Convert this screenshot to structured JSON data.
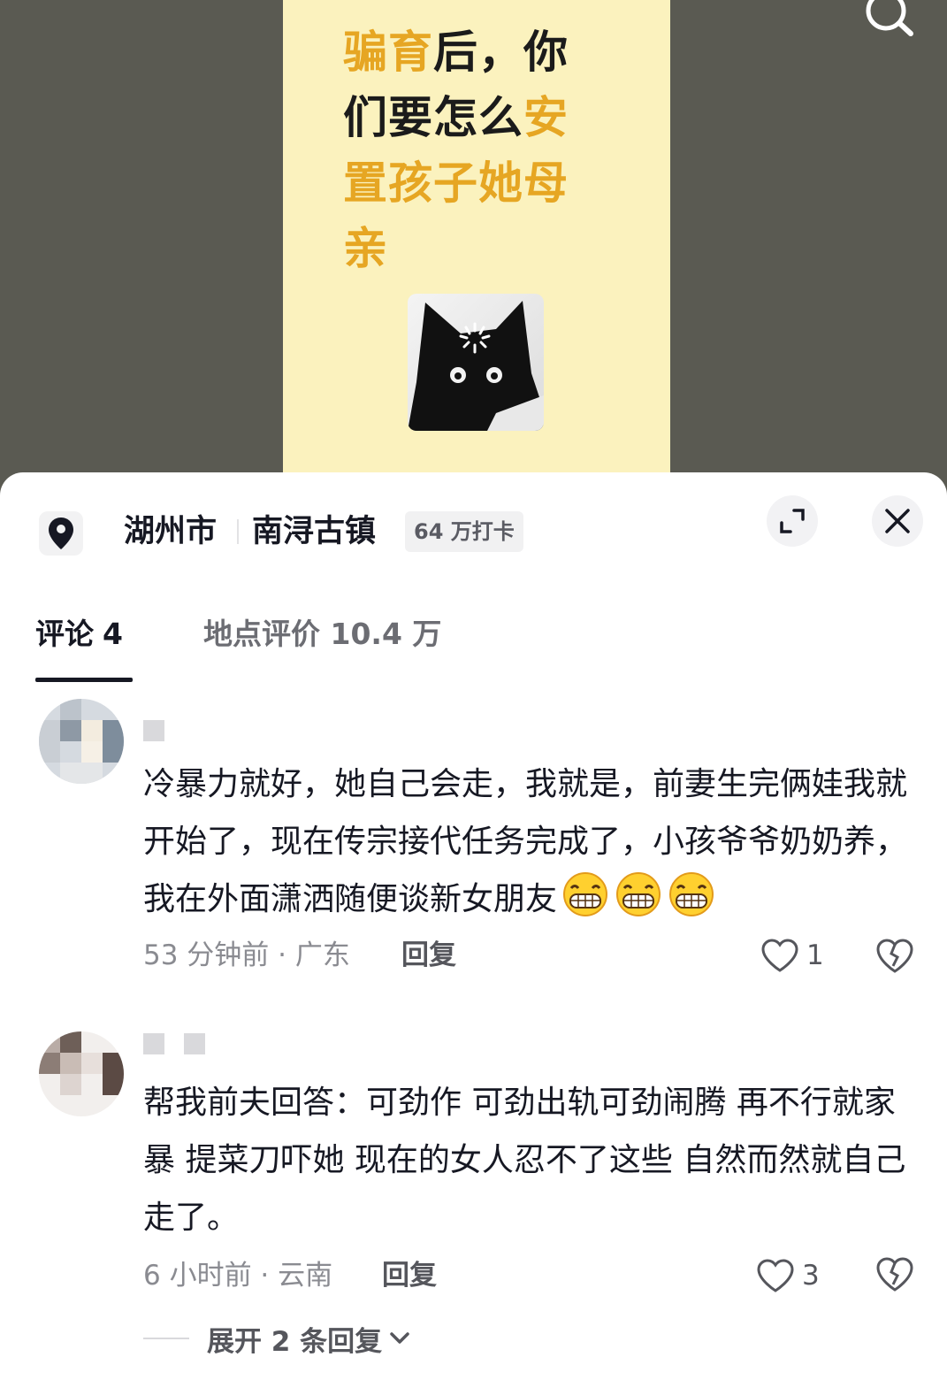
{
  "video": {
    "title_lines": [
      {
        "pre_hl": "骗育",
        "normal": "后，你",
        "post_hl": ""
      },
      {
        "pre_hl": "",
        "normal": "们要怎么",
        "post_hl": "安"
      },
      {
        "pre_hl": "置孩子她母",
        "normal": "",
        "post_hl": ""
      },
      {
        "pre_hl": "亲",
        "normal": "",
        "post_hl": ""
      }
    ],
    "accent_color": "#e6a623",
    "cat_image": "cat-loading-meme"
  },
  "location": {
    "city": "湖州市",
    "place": "南浔古镇",
    "checkins": "64 万打卡"
  },
  "tabs": {
    "comments_label": "评论",
    "comments_count": "4",
    "place_reviews": "地点评价 10.4 万"
  },
  "comments": [
    {
      "text": "冷暴力就好，她自己会走，我就是，前妻生完俩娃我就开始了，现在传宗接代任务完成了，小孩爷爷奶奶养，我在外面潇洒随便谈新女朋友",
      "emoji": [
        "grin-emoji",
        "grin-emoji",
        "grin-emoji"
      ],
      "meta": "53 分钟前 · 广东",
      "reply": "回复",
      "likes": "1"
    },
    {
      "text": "帮我前夫回答：可劲作 可劲出轨可劲闹腾 再不行就家暴 提菜刀吓她 现在的女人忍不了这些 自然而然就自己走了。",
      "meta": "6 小时前 · 云南",
      "reply": "回复",
      "likes": "3",
      "expand": "展开 2 条回复"
    }
  ]
}
